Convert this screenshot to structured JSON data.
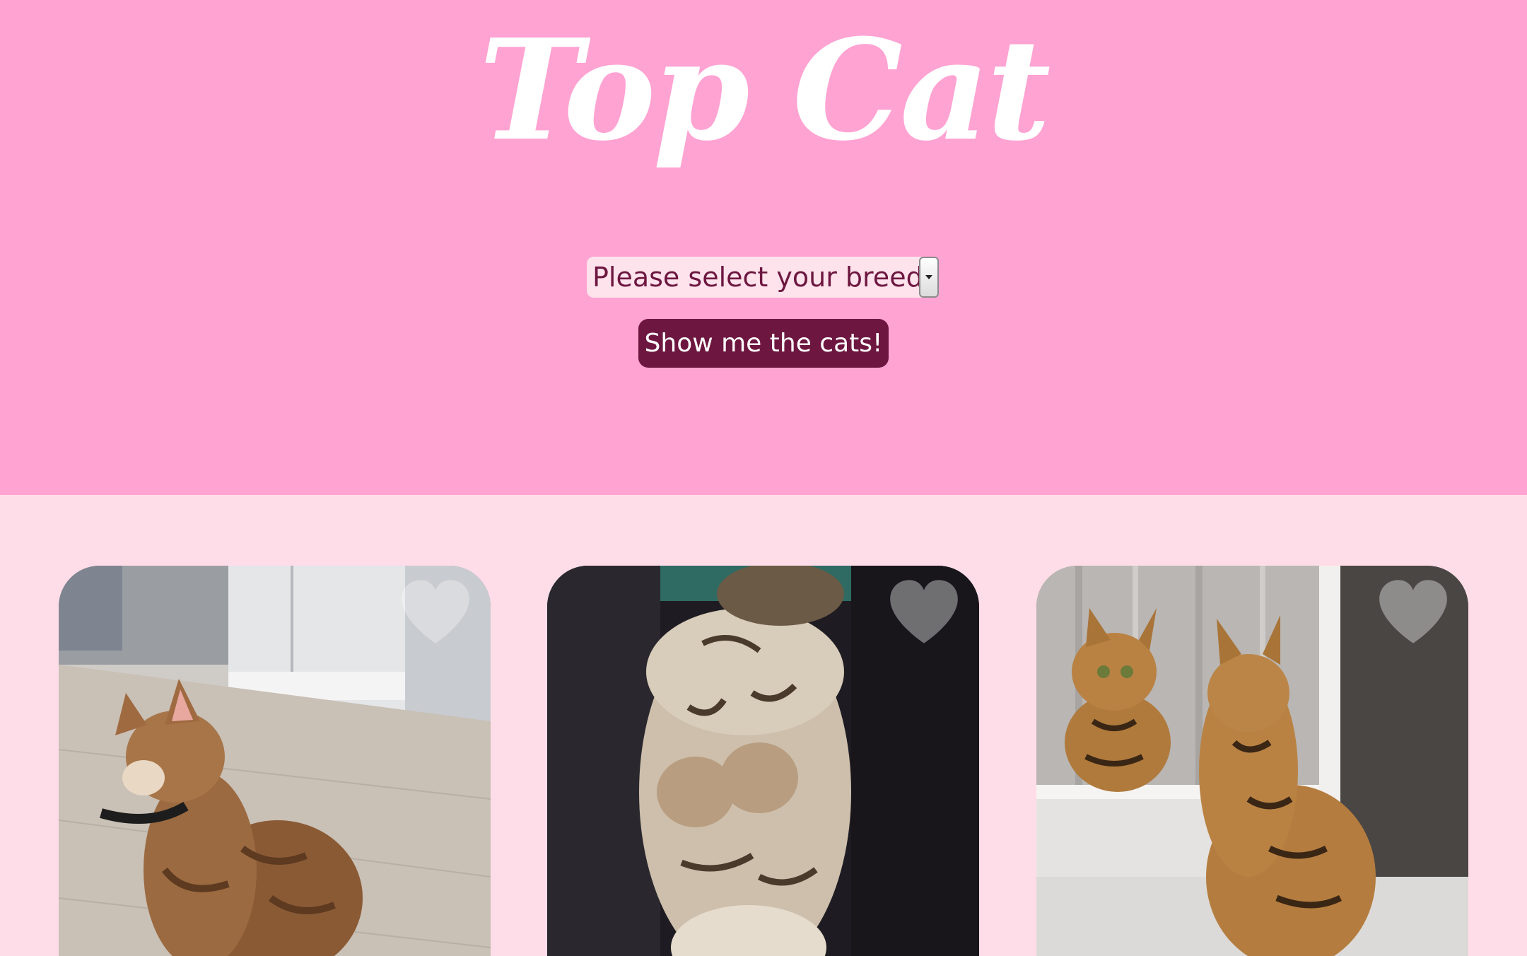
{
  "header": {
    "title": "Top Cat",
    "background_color": "#ffa3d3"
  },
  "breed_select": {
    "selected_label": "Please select your breed"
  },
  "actions": {
    "show_button_label": "Show me the cats!",
    "button_color": "#6d1740"
  },
  "gallery": {
    "background_color": "#ffdde8",
    "cards": [
      {
        "photo": "cat scratching in kitchen",
        "icon": "heart-icon"
      },
      {
        "photo": "kitten lying on back",
        "icon": "heart-icon"
      },
      {
        "photo": "cat looking at mirror",
        "icon": "heart-icon"
      }
    ]
  }
}
